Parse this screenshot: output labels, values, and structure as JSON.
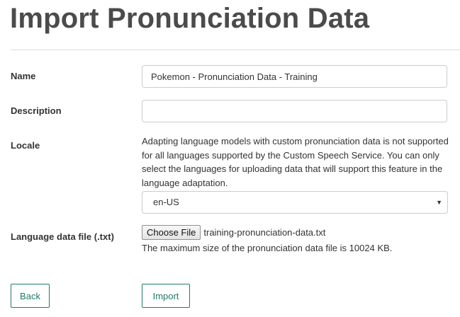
{
  "page": {
    "title": "Import Pronunciation Data"
  },
  "form": {
    "name": {
      "label": "Name",
      "value": "Pokemon - Pronunciation Data - Training"
    },
    "description": {
      "label": "Description",
      "value": ""
    },
    "locale": {
      "label": "Locale",
      "help": "Adapting language models with custom pronunciation data is not supported for all languages supported by the Custom Speech Service. You can only select the languages for uploading data that will support this feature in the language adaptation.",
      "selected": "en-US",
      "arrow_icon": "caret-down-icon"
    },
    "language_file": {
      "label": "Language data file (.txt)",
      "button_label": "Choose File",
      "file_name": "training-pronunciation-data.txt",
      "hint": "The maximum size of the pronunciation data file is 10024 KB."
    }
  },
  "actions": {
    "back_label": "Back",
    "import_label": "Import"
  },
  "colors": {
    "accent": "#217a6a",
    "title": "#4b4b4b",
    "border": "#cccccc"
  }
}
